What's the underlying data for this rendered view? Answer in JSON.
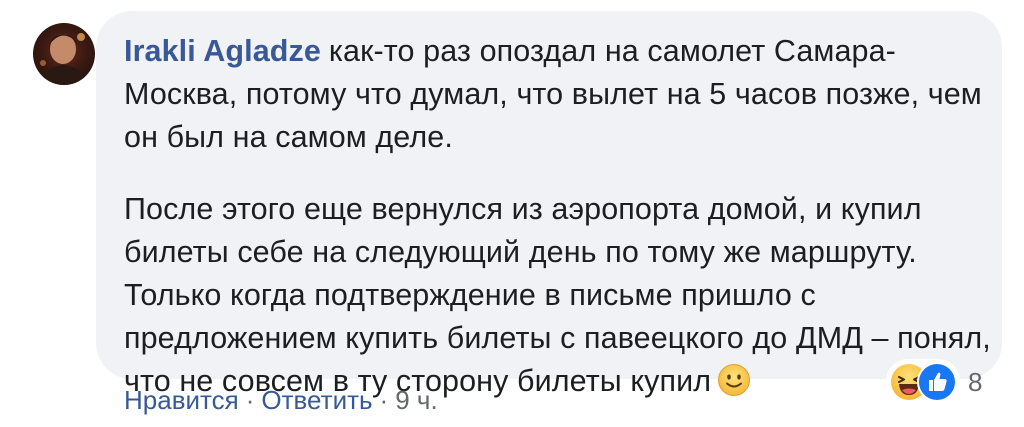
{
  "comment": {
    "author": "Irakli Agladze",
    "paragraph1": "как-то раз опоздал на самолет Самара-Москва, потому что думал, что вылет на 5 часов позже, чем он был на самом деле.",
    "paragraph2": "После этого еще вернулся из аэропорта домой, и купил билеты себе на следующий день по тому же маршруту. Только когда подтверждение в письме пришло с предложением купить билеты с павеецкого до ДМД – понял, что не совсем в ту сторону билеты купил",
    "emoji": "slightly-smiling-face-icon"
  },
  "actions": {
    "like_label": "Нравится",
    "reply_label": "Ответить",
    "separator": "·",
    "time": "9 ч."
  },
  "reactions": {
    "icons": [
      "laughing-face-icon",
      "thumbs-up-icon"
    ],
    "count": "8"
  },
  "colors": {
    "bubble": "#f0f2f5",
    "author": "#385898",
    "text": "#1c1e21",
    "meta": "#65676b",
    "like_blue": "#1877f2",
    "emoji_yellow": "#f7c94b"
  }
}
